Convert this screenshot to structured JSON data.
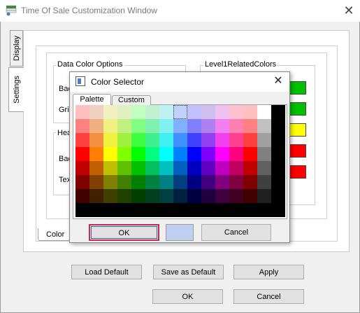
{
  "window": {
    "title": "Time Of Sale Customization Window"
  },
  "tabs": {
    "display": "Display",
    "settings": "Settings",
    "color": "Color"
  },
  "groups": {
    "data_color_options": "Data Color Options",
    "level1_related_colors": "Level1RelatedColors",
    "header_partial": "Hea",
    "label_bac_1": "Bac",
    "label_gri": "Gri",
    "label_bac_2": "Bac",
    "label_tex": "Tex"
  },
  "level1_swatches": [
    "#00c000",
    "#00c000",
    "#ffff00",
    "#ff0000",
    "#ff0000"
  ],
  "buttons": {
    "load_default": "Load Default",
    "save_as_default": "Save as Default",
    "apply": "Apply",
    "ok": "OK",
    "cancel": "Cancel"
  },
  "color_selector": {
    "title": "Color Selector",
    "tabs": [
      "Palette",
      "Custom"
    ],
    "selected_color": "#c0d0f0",
    "ok": "OK",
    "cancel": "Cancel",
    "palette_rows": [
      [
        "#ffc0c0",
        "#f0d0c0",
        "#f0f0c0",
        "#e0f0c0",
        "#c0ffc0",
        "#c0f0d0",
        "#c0f0f0",
        "#c0d0ff",
        "#c0c0ff",
        "#d0c0f0",
        "#f0c0f0",
        "#ffc0d0",
        "#ffc0c0",
        "#ffffff"
      ],
      [
        "#ff8080",
        "#f0b080",
        "#f0f080",
        "#c0f080",
        "#80ff80",
        "#80f0b0",
        "#80f0f0",
        "#80b0ff",
        "#8080ff",
        "#b080f0",
        "#f080f0",
        "#ff80b0",
        "#ff8080",
        "#c0c0c0"
      ],
      [
        "#ff4040",
        "#f09040",
        "#f0f040",
        "#a0f040",
        "#40ff40",
        "#40f090",
        "#40f0f0",
        "#4090ff",
        "#4040ff",
        "#9040f0",
        "#f040f0",
        "#ff4090",
        "#ff4040",
        "#a0a0a0"
      ],
      [
        "#ff0000",
        "#ff8000",
        "#ffff00",
        "#80ff00",
        "#00ff00",
        "#00ff80",
        "#00ffff",
        "#0080ff",
        "#0000ff",
        "#8000ff",
        "#ff00ff",
        "#ff0080",
        "#ff0000",
        "#808080"
      ],
      [
        "#c00000",
        "#c06000",
        "#c0c000",
        "#60c000",
        "#00c000",
        "#00c060",
        "#00c0c0",
        "#0060c0",
        "#0000c0",
        "#6000c0",
        "#c000c0",
        "#c00060",
        "#c00000",
        "#606060"
      ],
      [
        "#800000",
        "#804000",
        "#808000",
        "#408000",
        "#008000",
        "#008040",
        "#008080",
        "#004080",
        "#000080",
        "#400080",
        "#800080",
        "#800040",
        "#800000",
        "#404040"
      ],
      [
        "#400000",
        "#402000",
        "#404000",
        "#204000",
        "#004000",
        "#004020",
        "#004040",
        "#002040",
        "#000040",
        "#200040",
        "#400040",
        "#400020",
        "#400000",
        "#202020"
      ]
    ]
  }
}
